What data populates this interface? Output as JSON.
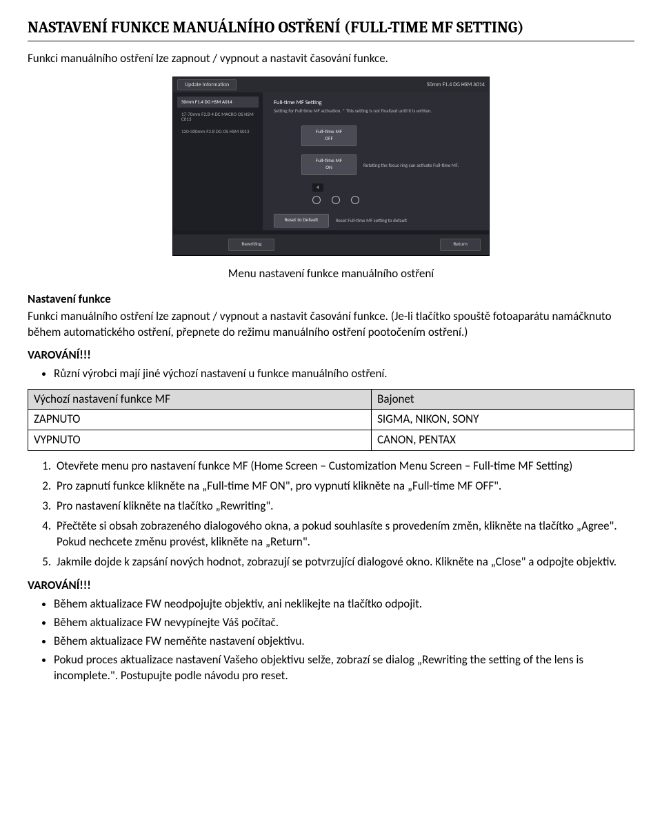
{
  "title": "NASTAVENÍ FUNKCE MANUÁLNÍHO OSTŘENÍ (FULL-TIME MF SETTING)",
  "intro": "Funkci manuálního ostření lze zapnout / vypnout a nastavit časování funkce.",
  "screenshot": {
    "topbar_left": "Update Information",
    "topbar_right": "50mm F1.4 DG HSM A014",
    "left_items": [
      "50mm F1.4 DG HSM A014",
      "17-70mm F2.8-4 DC MACRO OS HSM C013",
      "120-300mm F2.8 DG OS HSM S013"
    ],
    "right_title": "Full-time MF Setting",
    "right_sub": "Setting for Full-time MF activation.\n* This setting is not finalized until it is written.",
    "btn_off": "Full-time MF OFF",
    "btn_on": "Full-time MF ON",
    "on_desc": "Rotating the focus ring can activate Full-time MF.",
    "small_label": "4",
    "reset_btn": "Reset to Default",
    "reset_desc": "Reset Full-time MF setting to default",
    "bottom_btn1": "Rewriting",
    "bottom_btn2": "Return"
  },
  "caption": "Menu nastavení funkce manuálního ostření",
  "section": {
    "heading": "Nastavení funkce",
    "body": "Funkci manuálního ostření lze zapnout / vypnout a nastavit časování funkce. (Je-li tlačítko spouště fotoaparátu namáčknuto během automatického ostření, přepnete do režimu manuálního ostření pootočením ostření.)"
  },
  "warning1": {
    "head": "VAROVÁNÍ!!!",
    "bullet": "Různí výrobci mají jiné výchozí nastavení u funkce manuálního ostření."
  },
  "table": {
    "h1": "Výchozí nastavení funkce MF",
    "h2": "Bajonet",
    "r1c1": "ZAPNUTO",
    "r1c2": "SIGMA, NIKON, SONY",
    "r2c1": "VYPNUTO",
    "r2c2": "CANON, PENTAX"
  },
  "steps": [
    "Otevřete menu pro nastavení funkce MF (Home Screen – Customization Menu Screen – Full-time MF Setting)",
    "Pro zapnutí funkce klikněte na „Full-time MF ON\", pro vypnutí klikněte na „Full-time MF OFF\".",
    "Pro nastavení klikněte na tlačítko „Rewriting\".",
    "Přečtěte si obsah zobrazeného dialogového okna, a pokud souhlasíte s provedením změn, klikněte na tlačítko „Agree\". Pokud nechcete změnu provést, klikněte na „Return\".",
    "Jakmile dojde k zapsání nových hodnot, zobrazují se potvrzující dialogové okno. Klikněte na „Close\" a odpojte objektiv."
  ],
  "warning2": {
    "head": "VAROVÁNÍ!!!",
    "bullets": [
      "Během aktualizace FW neodpojujte objektiv, ani neklikejte na tlačítko odpojit.",
      "Během aktualizace FW nevypínejte Váš počítač.",
      "Během aktualizace FW neměňte nastavení objektivu.",
      "Pokud proces aktualizace nastavení Vašeho objektivu selže, zobrazí se dialog „Rewriting the setting of the lens is incomplete.\". Postupujte podle návodu pro reset."
    ]
  }
}
